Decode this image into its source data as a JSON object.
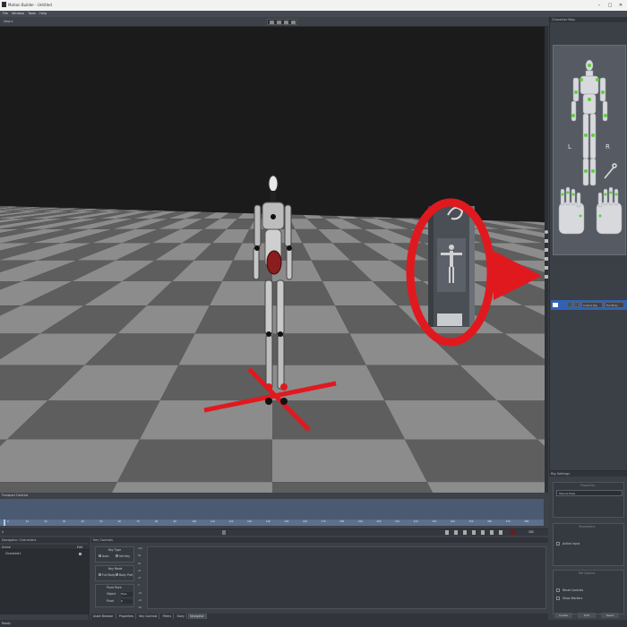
{
  "window": {
    "title": "Motion Builder - Untitled",
    "min": "–",
    "max": "□",
    "close": "✕"
  },
  "menu": [
    "File",
    "Window",
    "Tools",
    "Help"
  ],
  "toolbar": {
    "view_label": "View ▾"
  },
  "right_panel": {
    "title": "Character Map",
    "left_label": "L",
    "right_label": "R",
    "control_row": {
      "item_label": "Character",
      "rig_label": "Control Rig",
      "select_label": "Full Body"
    },
    "props_title": "Rig Settings",
    "props_group1": "Properties",
    "props_dropdown": "Stance Pose",
    "props_group2": "Parameters",
    "props_group3": "Ref Options",
    "props_check1": "Active Input",
    "props_check2": "Reset Controls",
    "props_check3": "Show Markers",
    "props_buttons": [
      "Create",
      "Edit",
      "Reset"
    ]
  },
  "timeline": {
    "title": "Transport Controls",
    "ticks": [
      "0",
      "10",
      "20",
      "30",
      "40",
      "50",
      "60",
      "70",
      "80",
      "90",
      "100",
      "110",
      "120",
      "130",
      "140",
      "150",
      "160",
      "170",
      "180",
      "190",
      "200",
      "210",
      "220",
      "230",
      "240",
      "250",
      "260",
      "270",
      "280"
    ],
    "current_frame": "0",
    "end_frame": "280"
  },
  "bottom": {
    "navigator_title": "Navigator: Characters",
    "nav_col1": "Scene",
    "nav_col2": "Edit",
    "nav_item": "Character1",
    "editor_title": "Key Controls",
    "group1_title": "Key Type",
    "radio1": "Auto",
    "radio2": "Set Key",
    "group2_title": "Key Mode",
    "radio3": "Full Body",
    "radio4": "Body Part",
    "group3_title": "Pivot Point",
    "field1_label": "Object",
    "field1_value": "Hips",
    "field2_label": "Pivot",
    "field2_value": "0",
    "y_ticks": [
      "100",
      "80",
      "60",
      "40",
      "20",
      "0",
      "-20",
      "-40",
      "-60"
    ],
    "tabs": [
      "Asset Browser",
      "Properties",
      "Key Controls",
      "Filters",
      "Story",
      "Navigator"
    ]
  },
  "status": {
    "text": "Ready"
  },
  "colors": {
    "accent": "#2f62b4",
    "highlight_red": "#e0191f",
    "joint_green": "#5fcf3a",
    "timeline": "#4a5a73"
  }
}
